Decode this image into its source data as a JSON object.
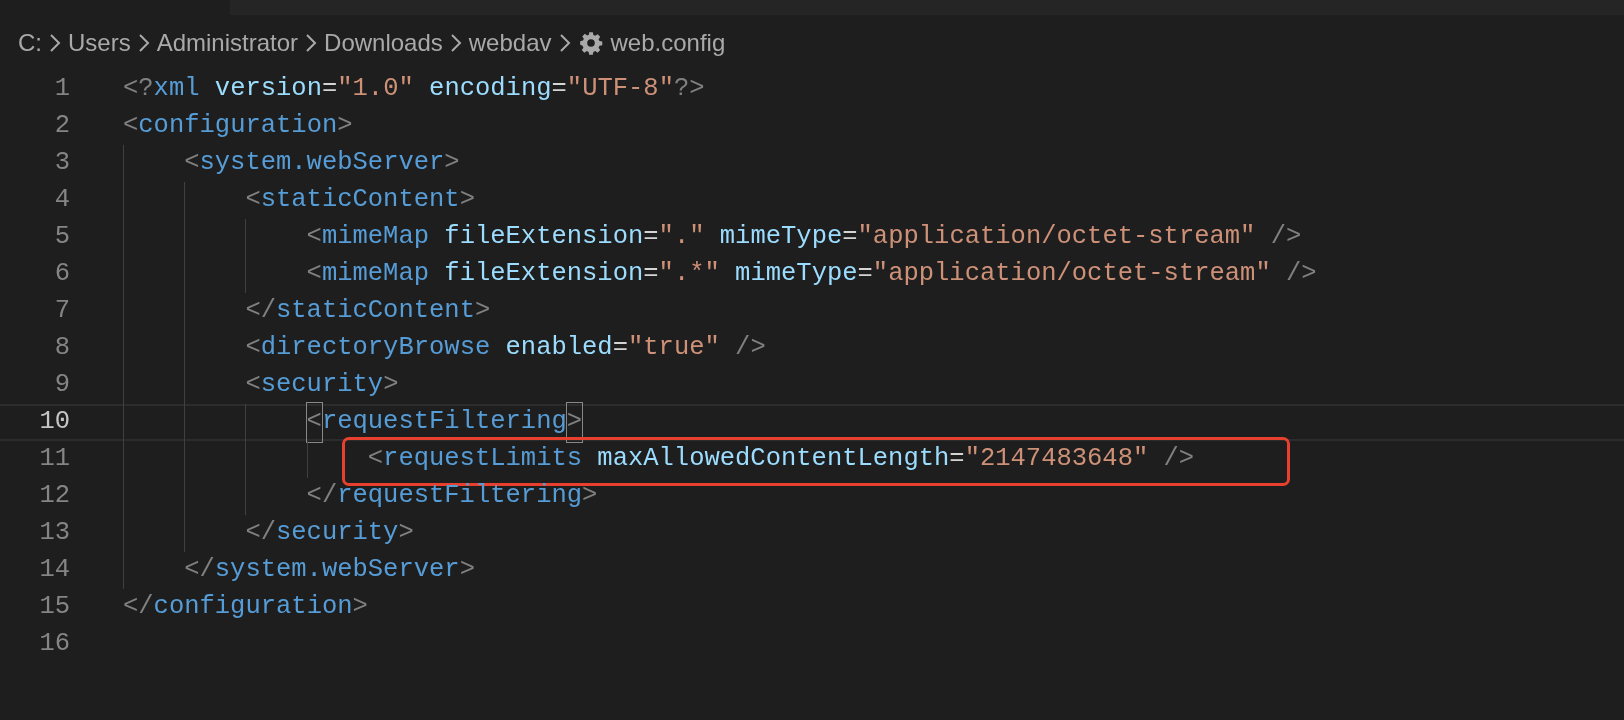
{
  "breadcrumbs": [
    {
      "label": "C:",
      "kind": "folder"
    },
    {
      "label": "Users",
      "kind": "folder"
    },
    {
      "label": "Administrator",
      "kind": "folder"
    },
    {
      "label": "Downloads",
      "kind": "folder"
    },
    {
      "label": "webdav",
      "kind": "folder"
    },
    {
      "label": "web.config",
      "kind": "config-file"
    }
  ],
  "lines": [
    {
      "number": "1",
      "current": false,
      "annotated": false,
      "tokens": [
        {
          "kind": "punct",
          "text": "<?"
        },
        {
          "kind": "tag",
          "text": "xml"
        },
        {
          "kind": "attr",
          "text": " version"
        },
        {
          "kind": "plain",
          "text": "="
        },
        {
          "kind": "string",
          "text": "\"1.0\""
        },
        {
          "kind": "attr",
          "text": " encoding"
        },
        {
          "kind": "plain",
          "text": "="
        },
        {
          "kind": "string",
          "text": "\"UTF-8\""
        },
        {
          "kind": "punct",
          "text": "?>"
        }
      ]
    },
    {
      "number": "2",
      "current": false,
      "annotated": false,
      "tokens": [
        {
          "kind": "punct",
          "text": "<"
        },
        {
          "kind": "tag",
          "text": "configuration"
        },
        {
          "kind": "punct",
          "text": ">"
        }
      ],
      "children": [
        {
          "number": "3",
          "current": false,
          "annotated": false,
          "tokens": [
            {
              "kind": "punct",
              "text": "<"
            },
            {
              "kind": "tag",
              "text": "system.webServer"
            },
            {
              "kind": "punct",
              "text": ">"
            }
          ],
          "children": [
            {
              "number": "4",
              "current": false,
              "annotated": false,
              "tokens": [
                {
                  "kind": "punct",
                  "text": "<"
                },
                {
                  "kind": "tag",
                  "text": "staticContent"
                },
                {
                  "kind": "punct",
                  "text": ">"
                }
              ],
              "children": [
                {
                  "number": "5",
                  "current": false,
                  "annotated": false,
                  "tokens": [
                    {
                      "kind": "punct",
                      "text": "<"
                    },
                    {
                      "kind": "tag",
                      "text": "mimeMap"
                    },
                    {
                      "kind": "attr",
                      "text": " fileExtension"
                    },
                    {
                      "kind": "plain",
                      "text": "="
                    },
                    {
                      "kind": "string",
                      "text": "\".\""
                    },
                    {
                      "kind": "attr",
                      "text": " mimeType"
                    },
                    {
                      "kind": "plain",
                      "text": "="
                    },
                    {
                      "kind": "string",
                      "text": "\"application/octet-stream\""
                    },
                    {
                      "kind": "punct",
                      "text": " />"
                    }
                  ]
                },
                {
                  "number": "6",
                  "current": false,
                  "annotated": false,
                  "tokens": [
                    {
                      "kind": "punct",
                      "text": "<"
                    },
                    {
                      "kind": "tag",
                      "text": "mimeMap"
                    },
                    {
                      "kind": "attr",
                      "text": " fileExtension"
                    },
                    {
                      "kind": "plain",
                      "text": "="
                    },
                    {
                      "kind": "string",
                      "text": "\".*\""
                    },
                    {
                      "kind": "attr",
                      "text": " mimeType"
                    },
                    {
                      "kind": "plain",
                      "text": "="
                    },
                    {
                      "kind": "string",
                      "text": "\"application/octet-stream\""
                    },
                    {
                      "kind": "punct",
                      "text": " />"
                    }
                  ]
                }
              ]
            },
            {
              "number": "7",
              "current": false,
              "annotated": false,
              "tokens": [
                {
                  "kind": "punct",
                  "text": "</"
                },
                {
                  "kind": "tag",
                  "text": "staticContent"
                },
                {
                  "kind": "punct",
                  "text": ">"
                }
              ]
            },
            {
              "number": "8",
              "current": false,
              "annotated": false,
              "tokens": [
                {
                  "kind": "punct",
                  "text": "<"
                },
                {
                  "kind": "tag",
                  "text": "directoryBrowse"
                },
                {
                  "kind": "attr",
                  "text": " enabled"
                },
                {
                  "kind": "plain",
                  "text": "="
                },
                {
                  "kind": "string",
                  "text": "\"true\""
                },
                {
                  "kind": "punct",
                  "text": " />"
                }
              ]
            },
            {
              "number": "9",
              "current": false,
              "annotated": false,
              "tokens": [
                {
                  "kind": "punct",
                  "text": "<"
                },
                {
                  "kind": "tag",
                  "text": "security"
                },
                {
                  "kind": "punct",
                  "text": ">"
                }
              ],
              "children": [
                {
                  "number": "10",
                  "current": true,
                  "annotated": false,
                  "tokens": [
                    {
                      "kind": "punct",
                      "text": "<",
                      "matched": true
                    },
                    {
                      "kind": "tag",
                      "text": "requestFiltering"
                    },
                    {
                      "kind": "punct",
                      "text": ">",
                      "matched": true
                    }
                  ],
                  "children": [
                    {
                      "number": "11",
                      "current": false,
                      "annotated": true,
                      "tokens": [
                        {
                          "kind": "punct",
                          "text": "<"
                        },
                        {
                          "kind": "tag",
                          "text": "requestLimits"
                        },
                        {
                          "kind": "attr",
                          "text": " maxAllowedContentLength"
                        },
                        {
                          "kind": "plain",
                          "text": "="
                        },
                        {
                          "kind": "string",
                          "text": "\"2147483648\""
                        },
                        {
                          "kind": "punct",
                          "text": " />"
                        }
                      ]
                    }
                  ]
                },
                {
                  "number": "12",
                  "current": false,
                  "annotated": false,
                  "tokens": [
                    {
                      "kind": "punct",
                      "text": "</"
                    },
                    {
                      "kind": "tag",
                      "text": "requestFiltering"
                    },
                    {
                      "kind": "punct",
                      "text": ">"
                    }
                  ]
                }
              ]
            },
            {
              "number": "13",
              "current": false,
              "annotated": false,
              "tokens": [
                {
                  "kind": "punct",
                  "text": "</"
                },
                {
                  "kind": "tag",
                  "text": "security"
                },
                {
                  "kind": "punct",
                  "text": ">"
                }
              ]
            }
          ]
        },
        {
          "number": "14",
          "current": false,
          "annotated": false,
          "tokens": [
            {
              "kind": "punct",
              "text": "</"
            },
            {
              "kind": "tag",
              "text": "system.webServer"
            },
            {
              "kind": "punct",
              "text": ">"
            }
          ]
        }
      ]
    },
    {
      "number": "15",
      "current": false,
      "annotated": false,
      "tokens": [
        {
          "kind": "punct",
          "text": "</"
        },
        {
          "kind": "tag",
          "text": "configuration"
        },
        {
          "kind": "punct",
          "text": ">"
        }
      ]
    },
    {
      "number": "16",
      "current": false,
      "annotated": false
    }
  ]
}
